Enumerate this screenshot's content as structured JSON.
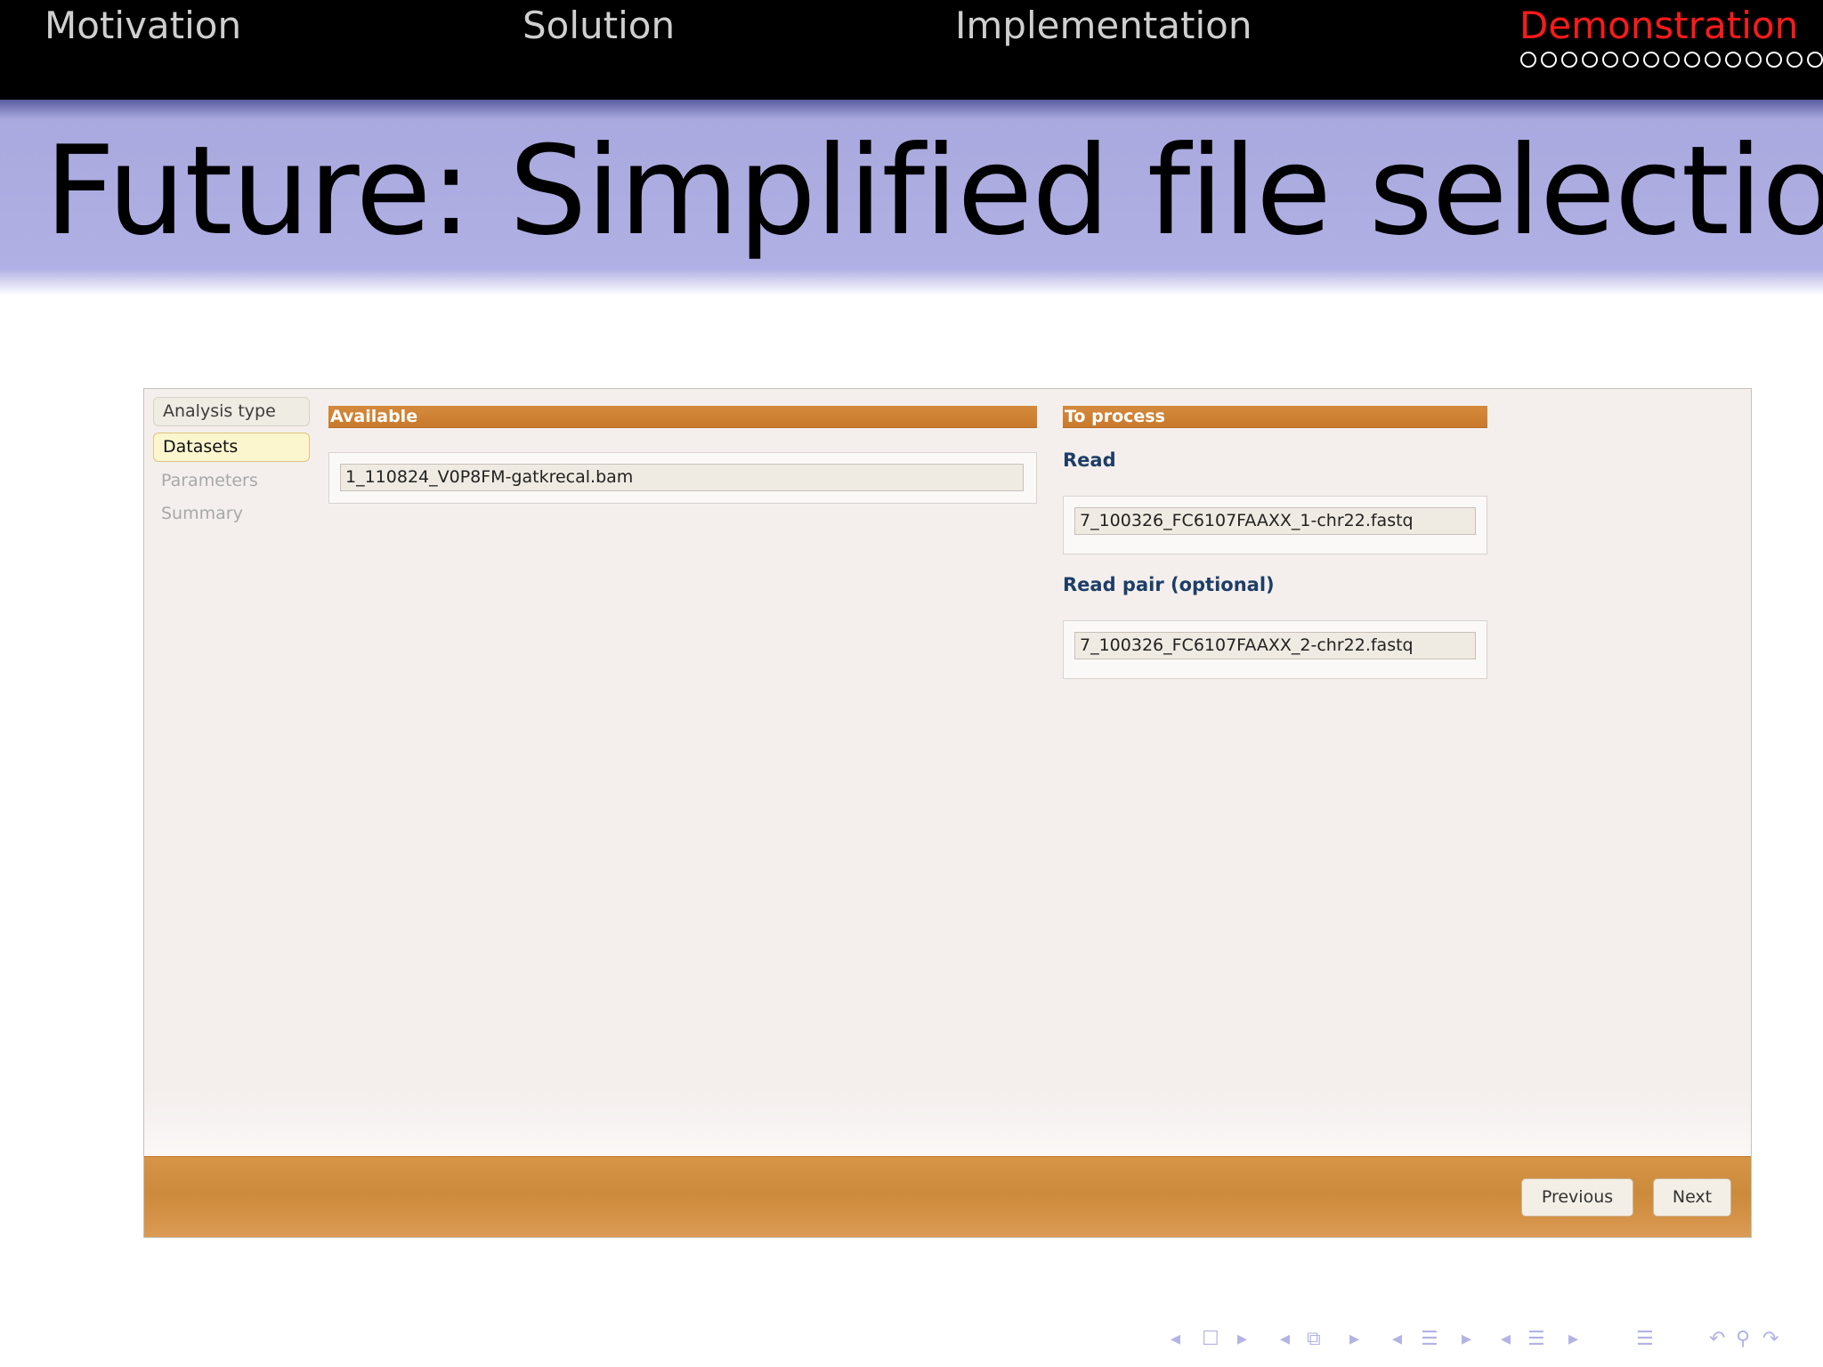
{
  "nav": {
    "sections": [
      {
        "label": "Motivation",
        "active": false
      },
      {
        "label": "Solution",
        "active": false
      },
      {
        "label": "Implementation",
        "active": false
      },
      {
        "label": "Demonstration",
        "active": true
      }
    ],
    "active_color": "#ff1a1a"
  },
  "frame": {
    "title": "Future:  Simplified file selection",
    "title_band_color": "#b0b0e4"
  },
  "app": {
    "steps": [
      {
        "label": "Analysis type",
        "state": "done"
      },
      {
        "label": "Datasets",
        "state": "current"
      },
      {
        "label": "Parameters",
        "state": "disabled"
      },
      {
        "label": "Summary",
        "state": "disabled"
      }
    ],
    "available": {
      "header": "Available",
      "files": [
        "1_110824_V0P8FM-gatkrecal.bam"
      ]
    },
    "to_process": {
      "header": "To process",
      "read_label": "Read",
      "read_file": "7_100326_FC6107FAAXX_1-chr22.fastq",
      "read_pair_label": "Read pair (optional)",
      "read_pair_file": "7_100326_FC6107FAAXX_2-chr22.fastq"
    },
    "footer": {
      "previous_label": "Previous",
      "next_label": "Next"
    },
    "accent_color": "#cf8c3e"
  },
  "nav_symbols": {
    "icons": [
      "arrow-left-icon",
      "frame-icon",
      "arrow-right-icon",
      "arrow-left-icon",
      "subsection-icon",
      "arrow-right-icon",
      "arrow-left-icon",
      "section-icon",
      "arrow-right-icon",
      "arrow-left-icon",
      "document-icon",
      "arrow-right-icon",
      "appendix-icon",
      "back-icon",
      "search-icon",
      "forward-icon"
    ]
  }
}
